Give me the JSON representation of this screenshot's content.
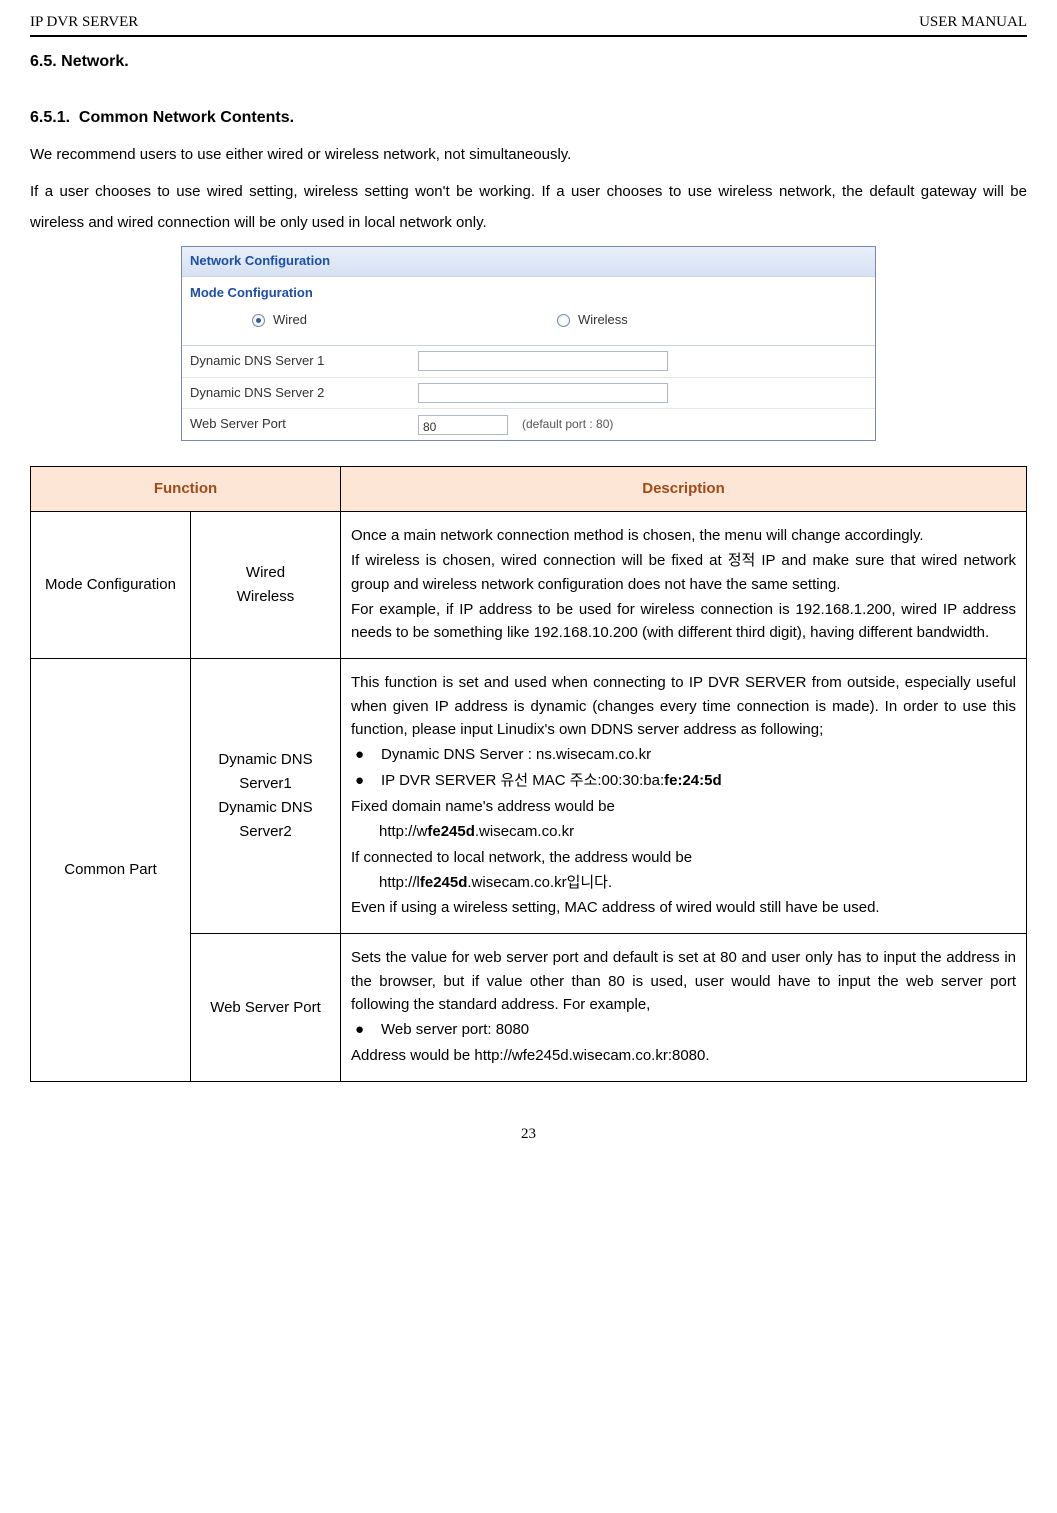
{
  "header": {
    "left": "IP DVR SERVER",
    "right": "USER MANUAL"
  },
  "section": {
    "num": "6.5.",
    "title": "Network."
  },
  "subsection": {
    "num": "6.5.1.",
    "title": "Common Network Contents."
  },
  "intro": {
    "p1": "We recommend users to use either wired or wireless network, not simultaneously.",
    "p2": "If a user chooses to use wired setting, wireless setting won't be working. If a user chooses to use wireless network, the default gateway will be wireless and wired connection will be only used in local network only."
  },
  "figure": {
    "title": "Network Configuration",
    "subtitle": "Mode Configuration",
    "radio": {
      "wired": "Wired",
      "wireless": "Wireless"
    },
    "rows": {
      "dns1": {
        "label": "Dynamic DNS Server 1"
      },
      "dns2": {
        "label": "Dynamic DNS Server 2"
      },
      "port": {
        "label": "Web Server Port",
        "value": "80",
        "hint": "(default port : 80)"
      }
    }
  },
  "table": {
    "headers": {
      "function": "Function",
      "description": "Description"
    },
    "r1": {
      "c1": "Mode Configuration",
      "c2a": "Wired",
      "c2b": "Wireless",
      "d1": "Once a main network connection method is chosen, the menu will change accordingly.",
      "d2a": "If wireless is chosen, wired connection will be fixed at ",
      "d2b": "정적",
      "d2c": " IP and make sure that wired network group and wireless network configuration does not have the same setting.",
      "d3": "For example, if IP address to be used for wireless connection is 192.168.1.200, wired IP address needs to be something like 192.168.10.200 (with different third digit), having different bandwidth."
    },
    "r2": {
      "c1": "Common Part",
      "a": {
        "c2a": "Dynamic DNS Server1",
        "c2b": "Dynamic DNS Server2",
        "d1": "This function is set and used when connecting to IP DVR SERVER from outside, especially useful when given IP address is dynamic (changes every time connection is made). In order to use this function, please input Linudix's own DDNS server address as following;",
        "b1": "Dynamic DNS Server : ns.wisecam.co.kr",
        "b2a": "IP DVR SERVER ",
        "b2b": "유선",
        "b2c": " MAC ",
        "b2d": "주소",
        "b2e": ":00:30:ba:",
        "b2f": "fe:24:5d",
        "d2": "Fixed domain name's address would be",
        "d3a": "http://w",
        "d3b": "fe245d",
        "d3c": ".wisecam.co.kr",
        "d4": "If connected to local network, the address would be",
        "d5a": "http://l",
        "d5b": "fe245d",
        "d5c": ".wisecam.co.kr",
        "d5d": "입니다.",
        "d6": "Even if using a wireless setting, MAC address of wired would still have be used."
      },
      "b": {
        "c2": "Web Server Port",
        "d1": "Sets the value for web server port and default is set at 80 and user only has to input the address in the browser, but if value other than 80 is used, user would have to input the web server port following the standard address. For example,",
        "b1": "Web server port: 8080",
        "d2": "Address would be http://wfe245d.wisecam.co.kr:8080."
      }
    }
  },
  "pagenum": "23",
  "bullet_sym": "●"
}
